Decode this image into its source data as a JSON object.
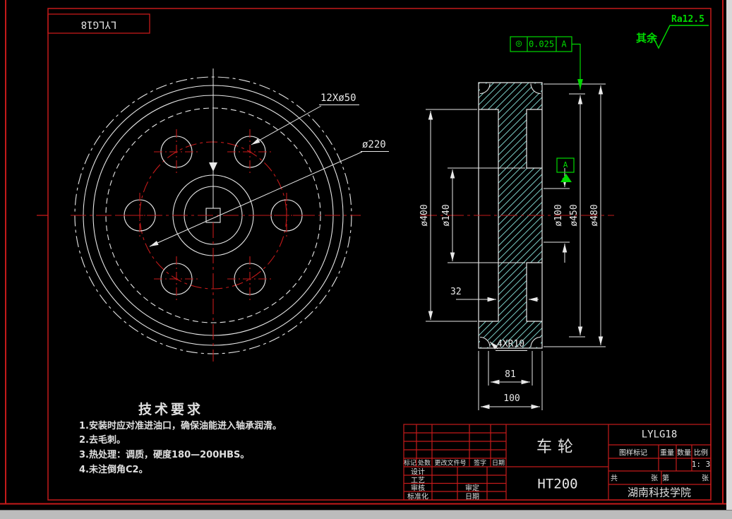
{
  "colors": {
    "line": "#e8e8e8",
    "red": "#c41a1a",
    "green": "#00d800",
    "hatch": "#8ae6de"
  },
  "corner_code": "LYLG18",
  "surface_note": {
    "prefix": "其余",
    "value": "Ra12.5"
  },
  "tolerance": {
    "symbol": "◎",
    "value": "0.025",
    "datum": "A"
  },
  "front_view": {
    "holes_label": "12Xø50",
    "bolt_circle_label": "ø220"
  },
  "section": {
    "d_outer": "ø480",
    "d_flange": "ø450",
    "d_rim": "ø400",
    "d_hub": "ø140",
    "d_bore": "ø100",
    "web_thickness": "32",
    "fillet": "4XR10",
    "width_inner": "81",
    "width_outer": "100",
    "datum_letter": "A"
  },
  "tech_requirements": {
    "title": "技术要求",
    "items": [
      "1.安装时应对准进油口，确保油能进入轴承润滑。",
      "2.去毛刺。",
      "3.热处理：调质，硬度180—200HBS。",
      "4.未注倒角C2。"
    ]
  },
  "title_block": {
    "part_name": "车轮",
    "material": "HT200",
    "drawing_code": "LYLG18",
    "organization": "湖南科技学院",
    "scale_value": "1: 3",
    "rev_headers": {
      "mark": "标记",
      "count": "处数",
      "doc": "更改文件号",
      "sign": "签字",
      "date": "日期"
    },
    "roles": {
      "design": "设计",
      "process": "工艺",
      "check": "审核",
      "standardize": "标准化",
      "approve": "审定",
      "date": "日期"
    },
    "right_headers": {
      "pattern_mark": "图样标记",
      "weight": "重量",
      "qty": "数量",
      "scale": "比例"
    },
    "sheet": {
      "total": "共",
      "sheet1": "张",
      "no": "第",
      "sheet2": "张"
    }
  }
}
